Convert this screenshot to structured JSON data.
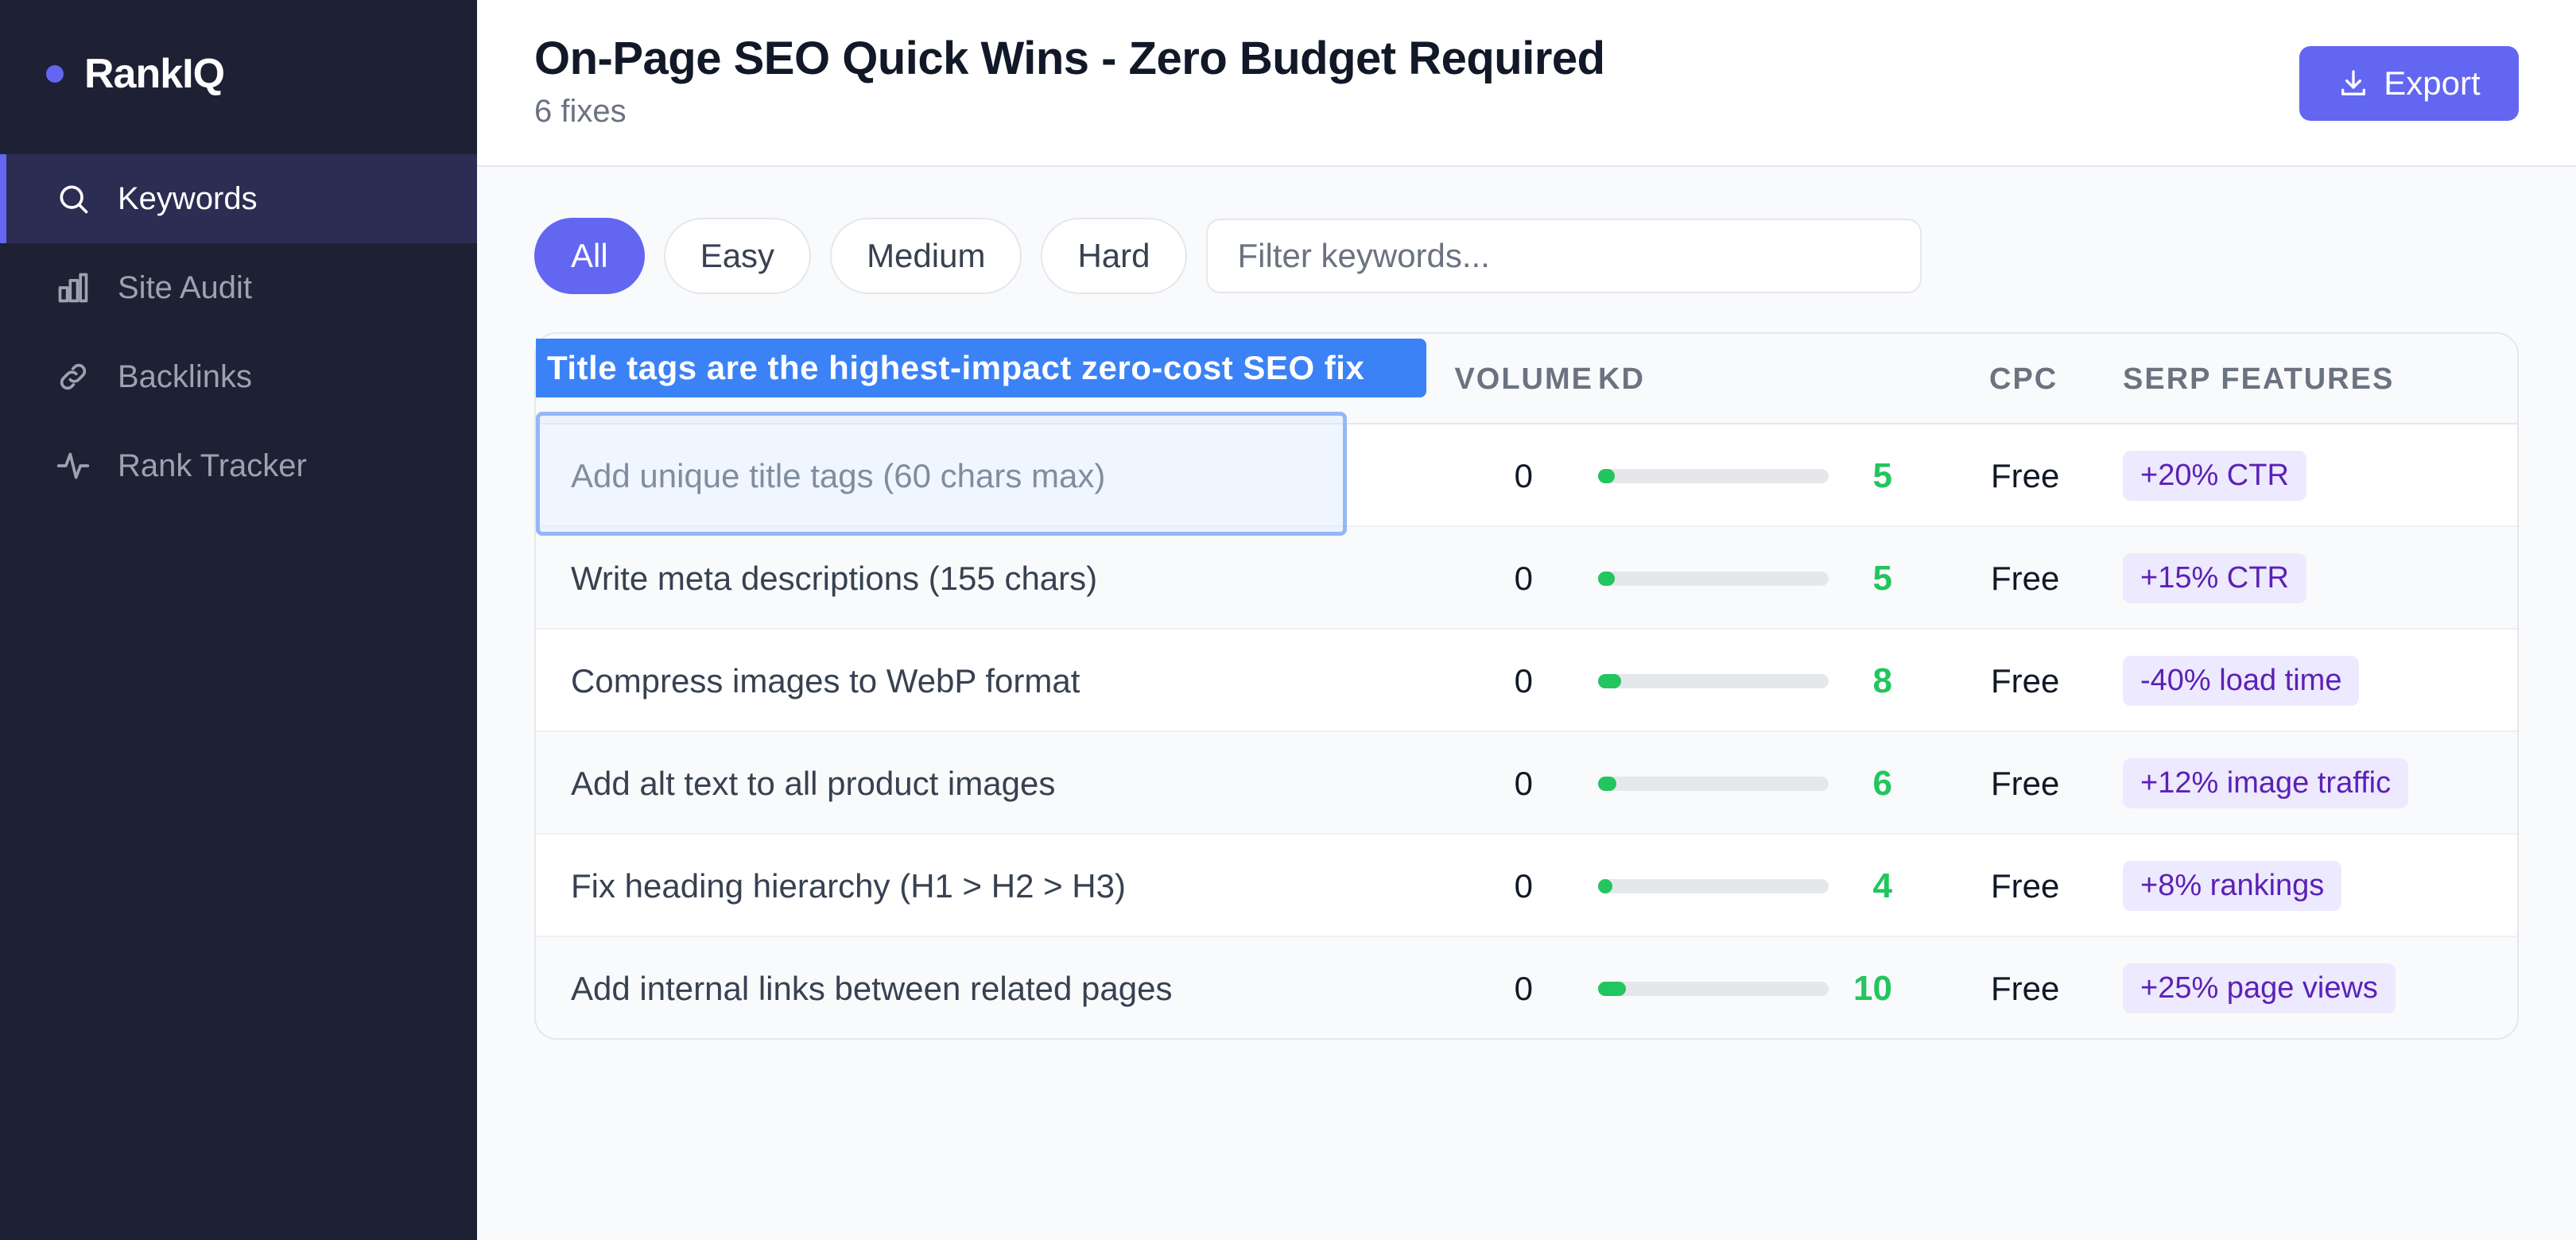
{
  "brand": {
    "name": "RankIQ",
    "accent": "#6366f1"
  },
  "nav": {
    "items": [
      {
        "label": "Keywords",
        "icon": "search-icon",
        "active": true
      },
      {
        "label": "Site Audit",
        "icon": "bar-chart-icon",
        "active": false
      },
      {
        "label": "Backlinks",
        "icon": "link-icon",
        "active": false
      },
      {
        "label": "Rank Tracker",
        "icon": "activity-icon",
        "active": false
      }
    ]
  },
  "header": {
    "title": "On-Page SEO Quick Wins - Zero Budget Required",
    "subtitle": "6 fixes",
    "export_label": "Export"
  },
  "filters": {
    "pills": [
      "All",
      "Easy",
      "Medium",
      "Hard"
    ],
    "active": "All",
    "search_placeholder": "Filter keywords..."
  },
  "table": {
    "columns": {
      "volume": "VOLUME",
      "kd": "KD",
      "cpc": "CPC",
      "serp": "SERP FEATURES"
    },
    "rows": [
      {
        "name": "Add unique title tags (60 chars max)",
        "volume": "0",
        "kd": "5",
        "cpc": "Free",
        "serp": "+20% CTR"
      },
      {
        "name": "Write meta descriptions (155 chars)",
        "volume": "0",
        "kd": "5",
        "cpc": "Free",
        "serp": "+15% CTR"
      },
      {
        "name": "Compress images to WebP format",
        "volume": "0",
        "kd": "8",
        "cpc": "Free",
        "serp": "-40% load time"
      },
      {
        "name": "Add alt text to all product images",
        "volume": "0",
        "kd": "6",
        "cpc": "Free",
        "serp": "+12% image traffic"
      },
      {
        "name": "Fix heading hierarchy (H1 > H2 > H3)",
        "volume": "0",
        "kd": "4",
        "cpc": "Free",
        "serp": "+8% rankings"
      },
      {
        "name": "Add internal links between related pages",
        "volume": "0",
        "kd": "10",
        "cpc": "Free",
        "serp": "+25% page views"
      }
    ]
  },
  "tooltip": {
    "text": "Title tags are the highest-impact zero-cost SEO fix"
  },
  "colors": {
    "kd_easy": "#22c55e",
    "badge_bg": "#ede9fe",
    "badge_text": "#5b21b6",
    "tooltip": "#3b82f6"
  }
}
